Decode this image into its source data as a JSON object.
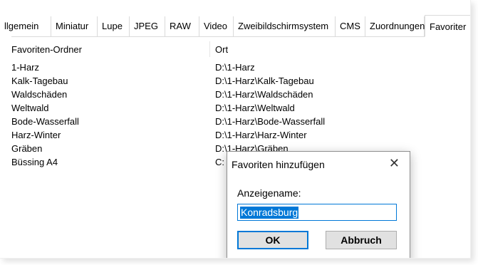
{
  "tabs": [
    {
      "label": "llgemein",
      "active": false
    },
    {
      "label": "Miniatur",
      "active": false
    },
    {
      "label": "Lupe",
      "active": false
    },
    {
      "label": "JPEG",
      "active": false
    },
    {
      "label": "RAW",
      "active": false
    },
    {
      "label": "Video",
      "active": false
    },
    {
      "label": "Zweibildschirmsystem",
      "active": false
    },
    {
      "label": "CMS",
      "active": false
    },
    {
      "label": "Zuordnungen",
      "active": false
    },
    {
      "label": "Favoriter",
      "active": true
    }
  ],
  "list": {
    "col_name_header": "Favoriten-Ordner",
    "col_path_header": "Ort",
    "rows": [
      {
        "name": "1-Harz",
        "path": "D:\\1-Harz"
      },
      {
        "name": "Kalk-Tagebau",
        "path": "D:\\1-Harz\\Kalk-Tagebau"
      },
      {
        "name": "Waldschäden",
        "path": "D:\\1-Harz\\Waldschäden"
      },
      {
        "name": "Weltwald",
        "path": "D:\\1-Harz\\Weltwald"
      },
      {
        "name": "Bode-Wasserfall",
        "path": "D:\\1-Harz\\Bode-Wasserfall"
      },
      {
        "name": "Harz-Winter",
        "path": "D:\\1-Harz\\Harz-Winter"
      },
      {
        "name": "Gräben",
        "path": "D:\\1-Harz\\Gräben"
      },
      {
        "name": "Büssing A4",
        "path": "C:"
      }
    ]
  },
  "dialog": {
    "title": "Favoriten hinzufügen",
    "close_glyph": "✕",
    "label": "Anzeigename:",
    "input_value": "Konradsburg",
    "ok_label": "OK",
    "cancel_label": "Abbruch"
  },
  "colors": {
    "accent": "#0078d7",
    "button_bg": "#e1e1e1"
  }
}
